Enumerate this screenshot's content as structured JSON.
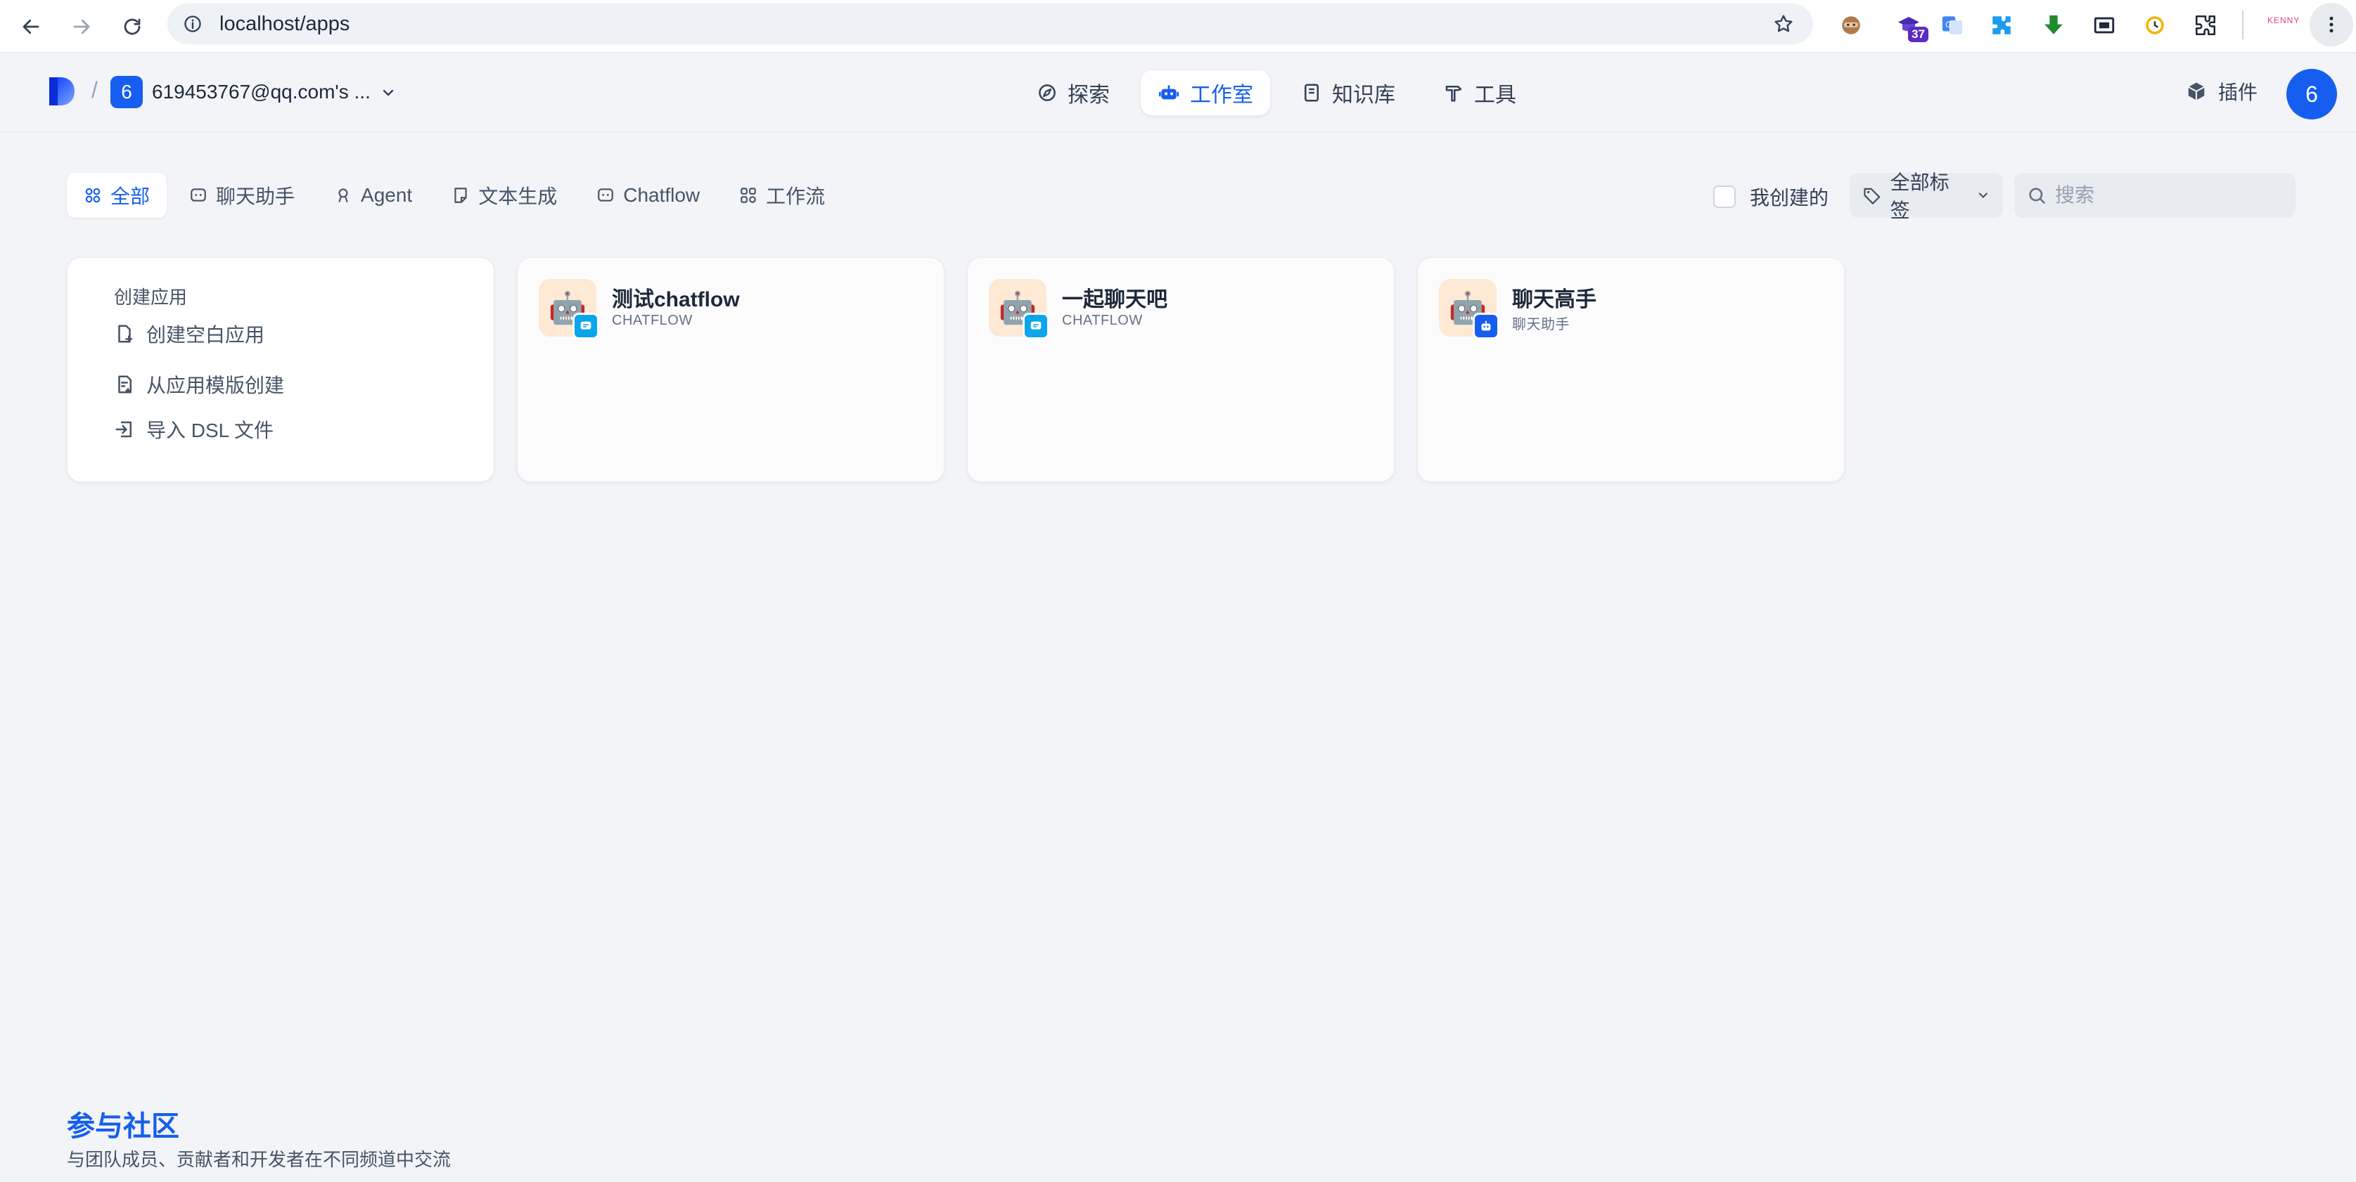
{
  "browser": {
    "url": "localhost/apps",
    "extension_badge": "37",
    "extension_brand": "KENNY"
  },
  "header": {
    "workspace_initial": "6",
    "workspace_name": "619453767@qq.com's ...",
    "nav": [
      {
        "label": "探索",
        "icon": "compass-icon"
      },
      {
        "label": "工作室",
        "icon": "robot-icon"
      },
      {
        "label": "知识库",
        "icon": "book-icon"
      },
      {
        "label": "工具",
        "icon": "hammer-icon"
      }
    ],
    "active_nav": "工作室",
    "plugin_label": "插件",
    "user_initial": "6"
  },
  "filters": {
    "tabs": [
      {
        "label": "全部",
        "icon": "grid-icon"
      },
      {
        "label": "聊天助手",
        "icon": "chat-icon"
      },
      {
        "label": "Agent",
        "icon": "agent-icon"
      },
      {
        "label": "文本生成",
        "icon": "document-icon"
      },
      {
        "label": "Chatflow",
        "icon": "chat-icon"
      },
      {
        "label": "工作流",
        "icon": "workflow-icon"
      }
    ],
    "active_tab": "全部",
    "mine_label": "我创建的",
    "tags_label": "全部标签",
    "search_placeholder": "搜索"
  },
  "create": {
    "title": "创建应用",
    "items": [
      {
        "label": "创建空白应用",
        "icon": "file-plus-icon"
      },
      {
        "label": "从应用模版创建",
        "icon": "template-icon"
      },
      {
        "label": "导入 DSL 文件",
        "icon": "import-icon"
      }
    ]
  },
  "apps": [
    {
      "name": "测试chatflow",
      "type": "CHATFLOW",
      "icon": "robot-emoji",
      "badge_color": "#0ba5ec"
    },
    {
      "name": "一起聊天吧",
      "type": "CHATFLOW",
      "icon": "robot-emoji",
      "badge_color": "#0ba5ec"
    },
    {
      "name": "聊天高手",
      "type": "聊天助手",
      "icon": "robot-emoji",
      "badge_color": "#155eef"
    }
  ],
  "community": {
    "title": "参与社区",
    "description": "与团队成员、贡献者和开发者在不同频道中交流"
  }
}
